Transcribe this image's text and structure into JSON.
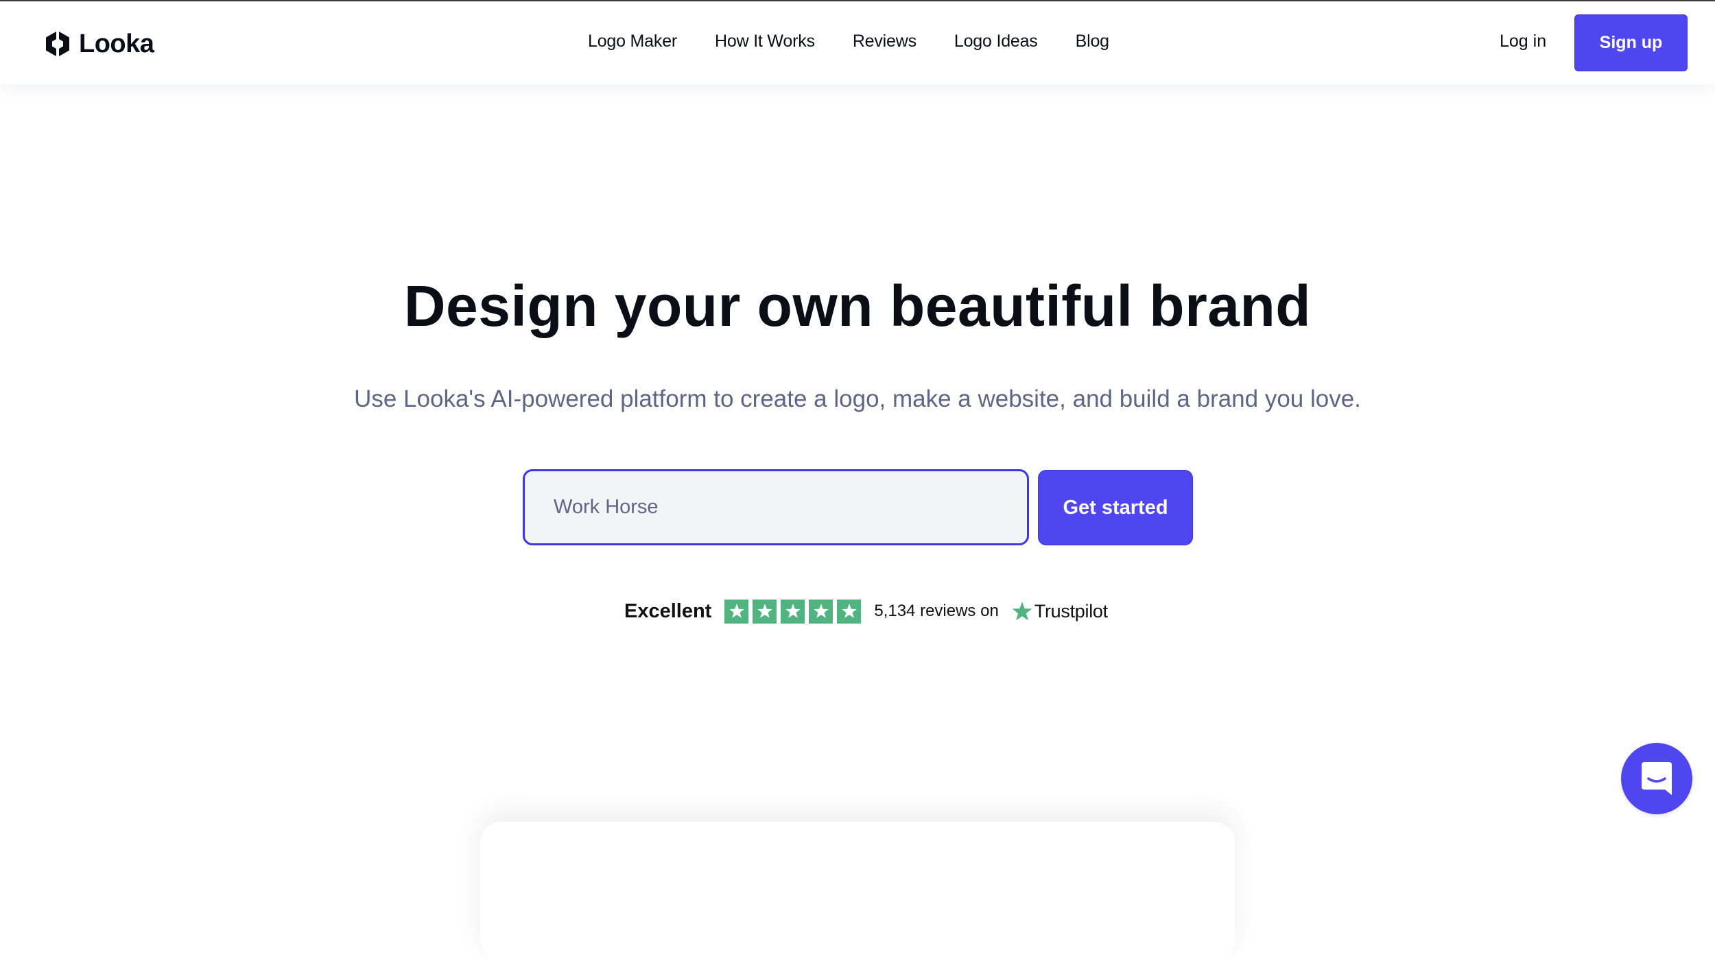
{
  "brand": {
    "name": "Looka",
    "logo_icon": "hexagon-logo-icon"
  },
  "nav": {
    "items": [
      {
        "label": "Logo Maker"
      },
      {
        "label": "How It Works"
      },
      {
        "label": "Reviews"
      },
      {
        "label": "Logo Ideas"
      },
      {
        "label": "Blog"
      }
    ],
    "login_label": "Log in",
    "signup_label": "Sign up"
  },
  "hero": {
    "title": "Design your own beautiful brand",
    "subtitle": "Use Looka's AI-powered platform to create a logo, make a website, and build a brand you love.",
    "input_value": "Work Horse",
    "cta_label": "Get started"
  },
  "trust": {
    "rating_label": "Excellent",
    "stars": 5,
    "reviews_text": "5,134 reviews on",
    "provider": "Trustpilot",
    "provider_icon": "trustpilot-star-icon"
  },
  "chat": {
    "icon": "chat-bubble-icon"
  },
  "colors": {
    "accent": "#4f46f0",
    "text": "#0b0d17",
    "muted": "#5e6585",
    "input_bg": "#f3f4f6",
    "trustpilot_green": "#51b37f"
  }
}
